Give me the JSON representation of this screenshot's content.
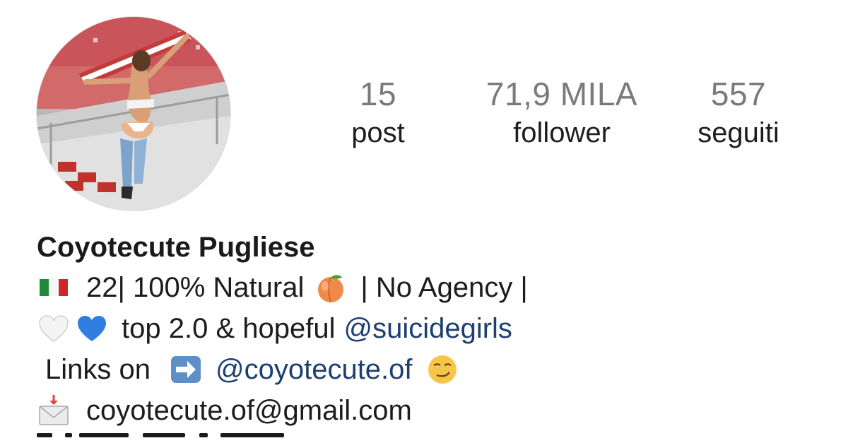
{
  "profile": {
    "avatar_icon": "profile-photo",
    "stats": {
      "posts": {
        "value": "15",
        "label": "post"
      },
      "followers": {
        "value": "71,9 MILA",
        "label": "follower"
      },
      "following": {
        "value": "557",
        "label": "seguiti"
      }
    },
    "name": "Coyotecute Pugliese",
    "bio": {
      "line1": {
        "icons": [
          "italy-flag-icon",
          "peach-icon"
        ],
        "text_a": "22| 100% Natural",
        "text_b": "| No Agency |"
      },
      "line2": {
        "icons": [
          "white-heart-icon",
          "blue-heart-icon"
        ],
        "text": "top 2.0 & hopeful",
        "mention": "@suicidegirls"
      },
      "line3": {
        "icons": [
          "right-arrow-icon",
          "smirking-face-icon"
        ],
        "text": "Links on",
        "mention": "@coyotecute.of"
      },
      "line4": {
        "icons": [
          "incoming-envelope-icon"
        ],
        "email": "coyotecute.of@gmail.com"
      }
    }
  },
  "colors": {
    "stat_number": "#7a7a7a",
    "text": "#1c1c1c",
    "mention": "#1c3f70"
  }
}
